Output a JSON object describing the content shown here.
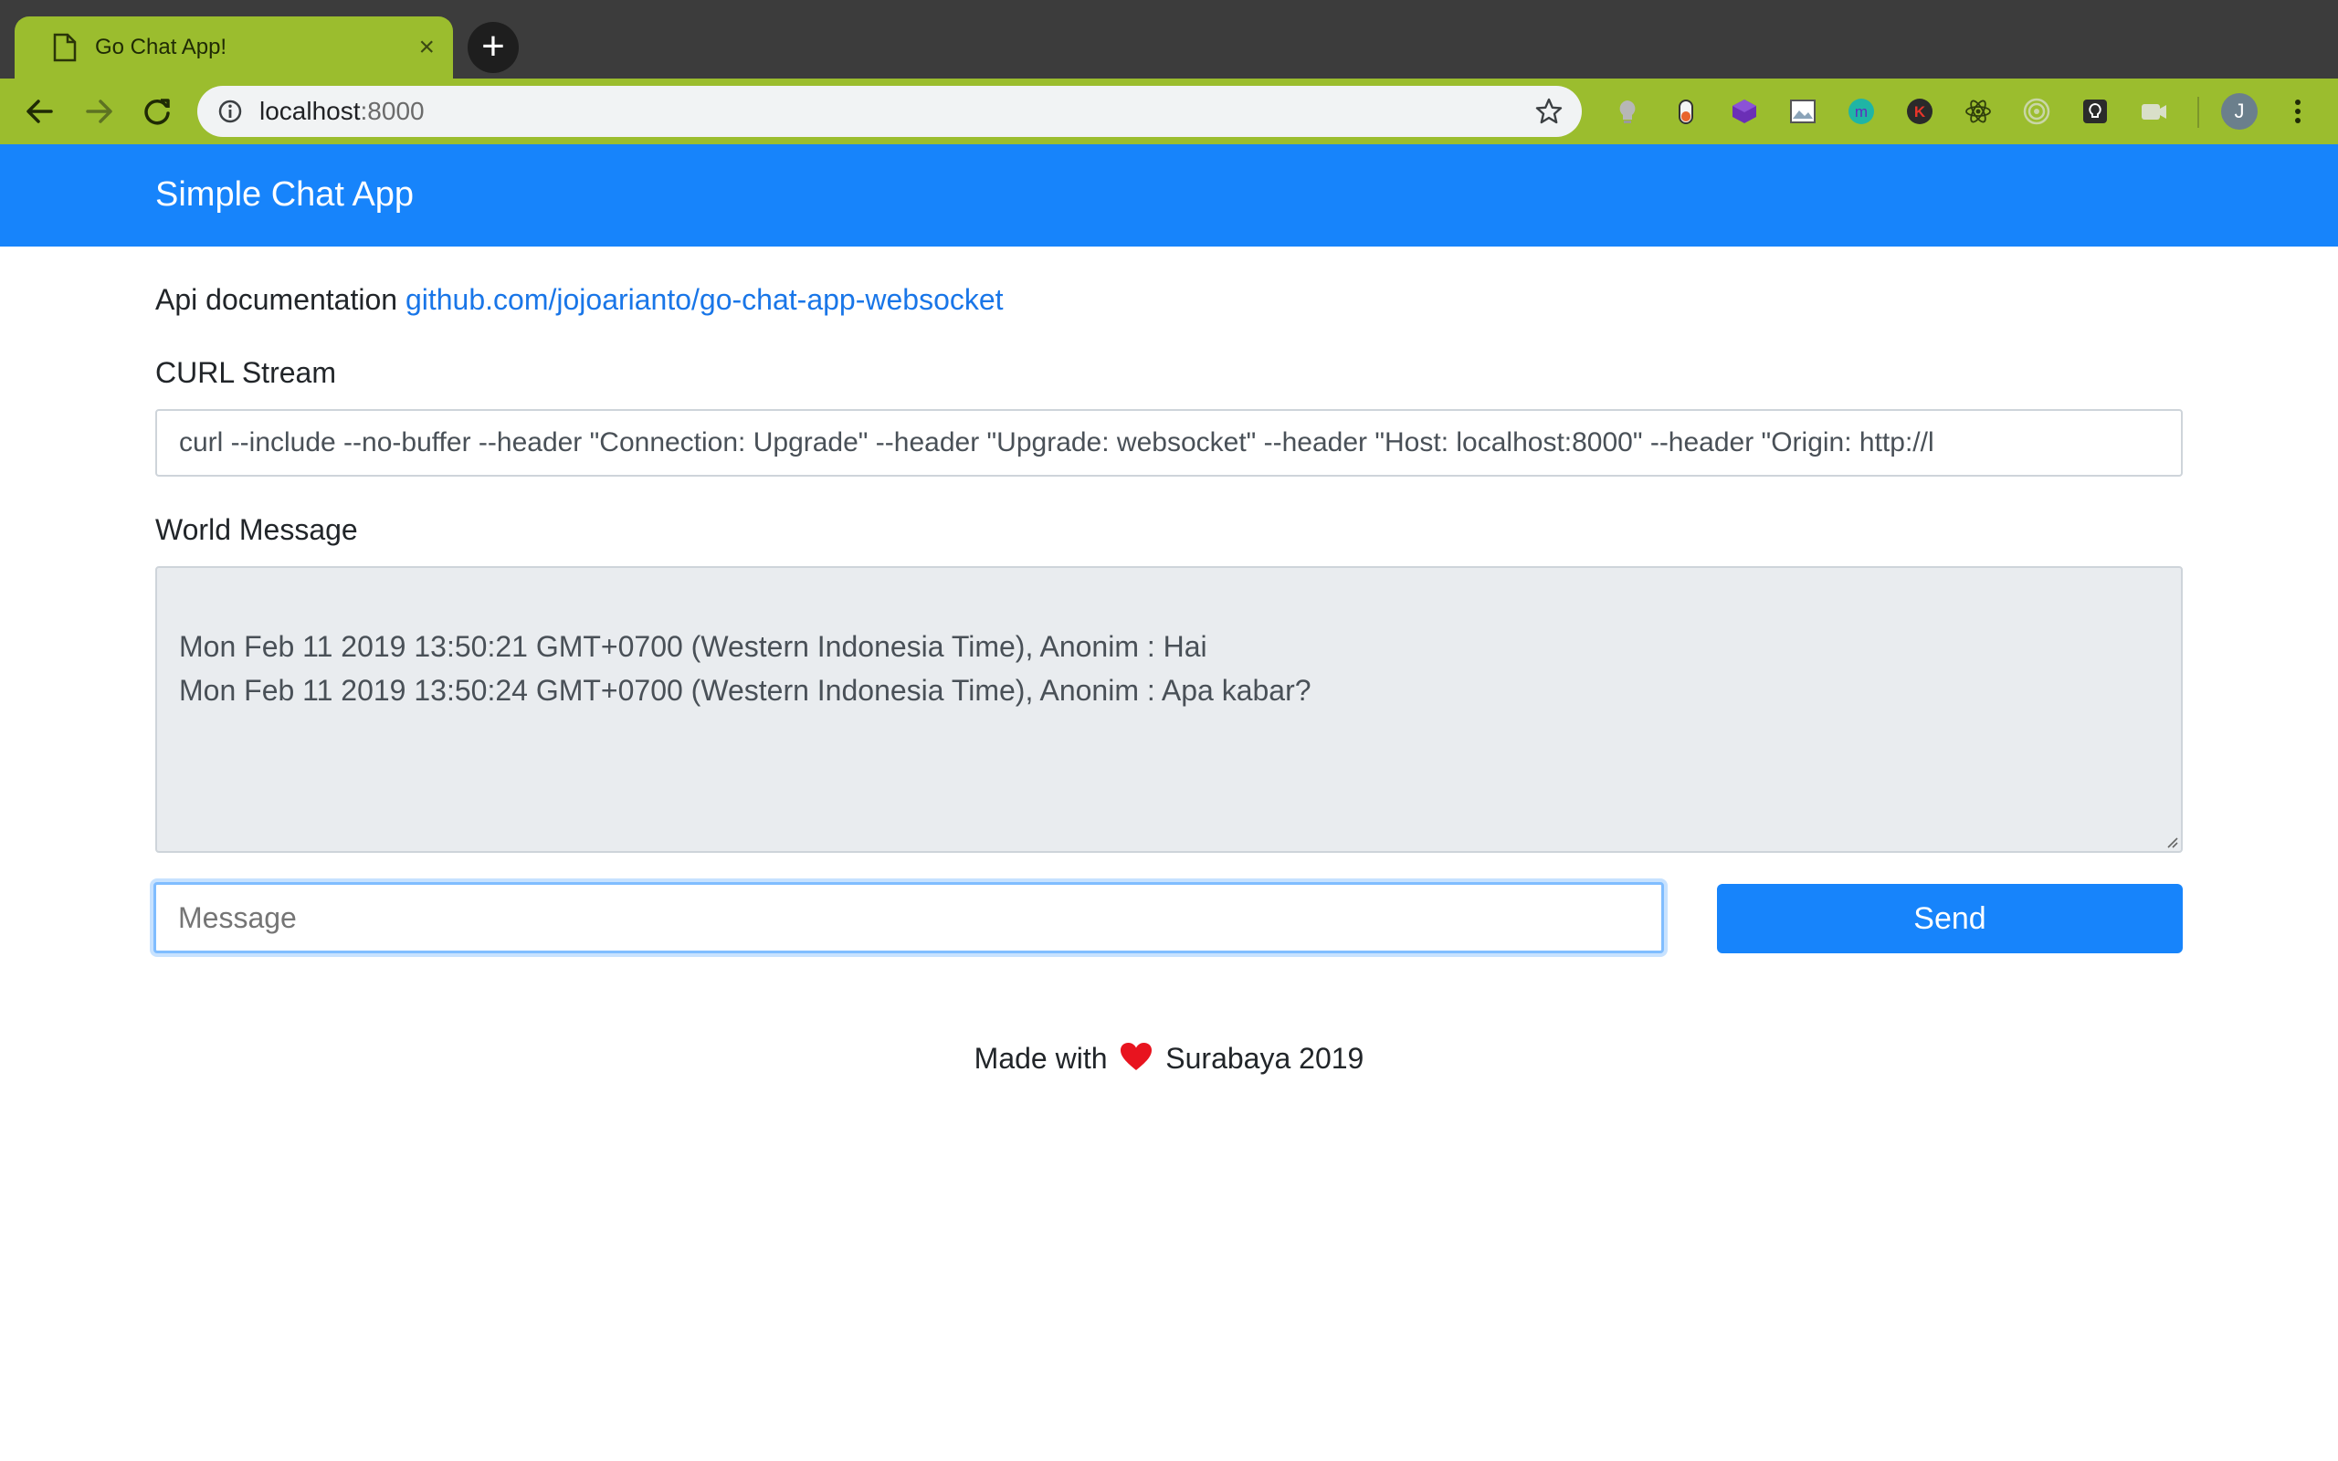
{
  "browser": {
    "tab_title": "Go Chat App!",
    "tab_close": "×",
    "new_tab": "+",
    "url_host": "localhost",
    "url_port": ":8000",
    "profile_initial": "J"
  },
  "navbar": {
    "brand": "Simple Chat App"
  },
  "api": {
    "label": "Api documentation",
    "link_text": "github.com/jojoarianto/go-chat-app-websocket"
  },
  "curl": {
    "label": "CURL Stream",
    "value": "curl --include --no-buffer --header \"Connection: Upgrade\" --header \"Upgrade: websocket\" --header \"Host: localhost:8000\" --header \"Origin: http://l"
  },
  "world": {
    "label": "World Message",
    "messages": [
      "Mon Feb 11 2019 13:50:21 GMT+0700 (Western Indonesia Time), Anonim : Hai",
      "Mon Feb 11 2019 13:50:24 GMT+0700 (Western Indonesia Time), Anonim : Apa kabar?"
    ]
  },
  "composer": {
    "placeholder": "Message",
    "send_label": "Send"
  },
  "footer": {
    "prefix": "Made with",
    "suffix": "Surabaya 2019"
  },
  "colors": {
    "primary": "#1784fb",
    "chrome_green": "#9bbd2e",
    "heart": "#e8141f"
  }
}
